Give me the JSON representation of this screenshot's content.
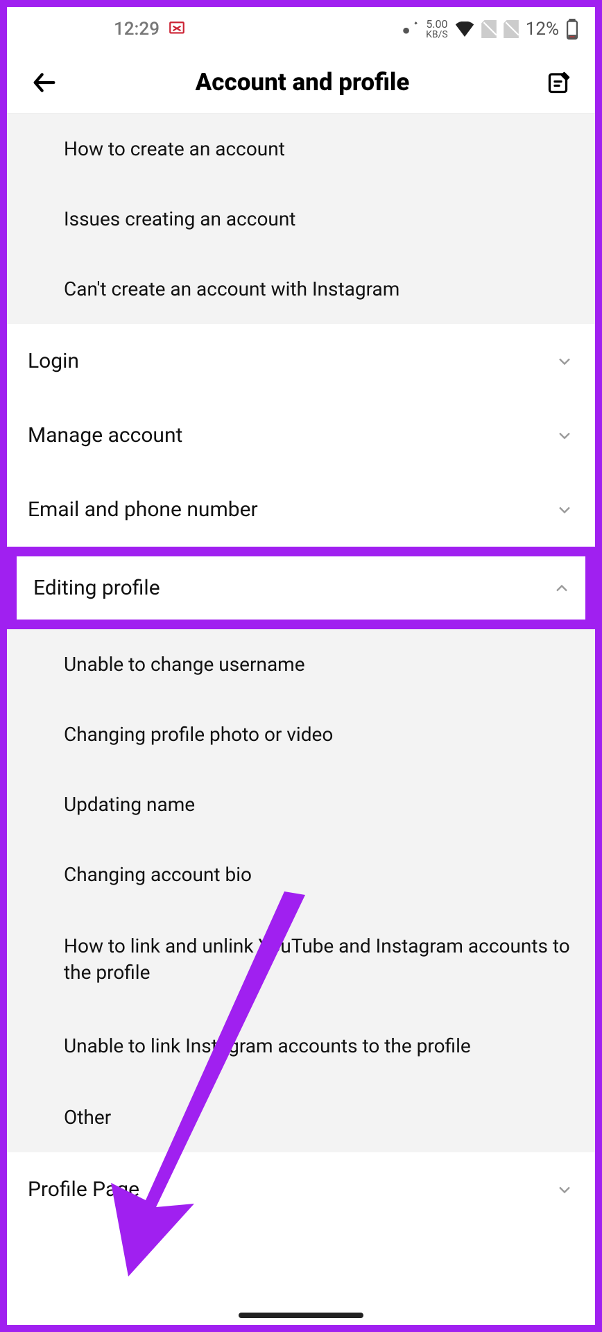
{
  "status": {
    "time": "12:29",
    "kbs_value": "5.00",
    "kbs_label": "KB/S",
    "battery_pct": "12%"
  },
  "header": {
    "title": "Account and profile"
  },
  "top_sub_items": [
    "How to create an account",
    "Issues creating an account",
    "Can't create an account with Instagram"
  ],
  "sections": {
    "login": "Login",
    "manage": "Manage account",
    "email_phone": "Email and phone number",
    "editing_profile": "Editing profile",
    "profile_page": "Profile Page"
  },
  "editing_sub_items": [
    "Unable to change username",
    "Changing profile photo or video",
    "Updating name",
    "Changing account bio",
    "How to link and unlink YouTube and Instagram accounts to the profile",
    "Unable to link Instagram accounts to the profile",
    "Other"
  ]
}
